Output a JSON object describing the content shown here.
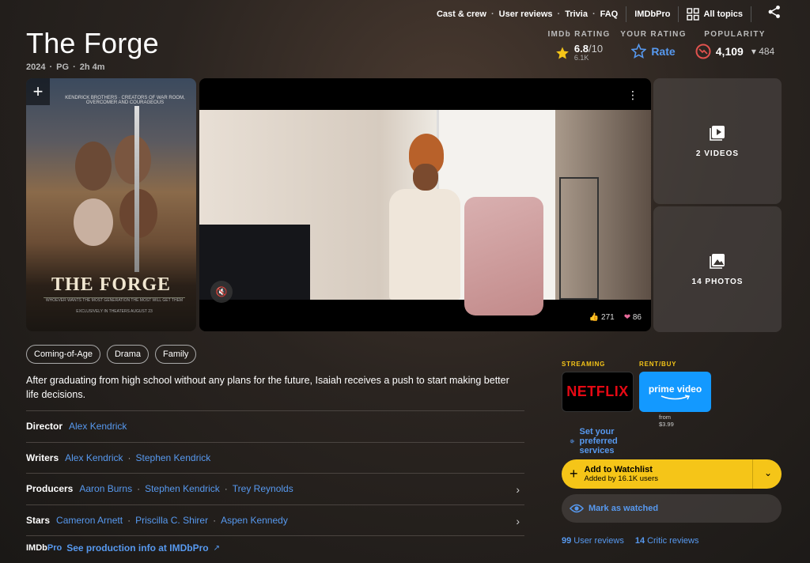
{
  "nav": {
    "links": [
      "Cast & crew",
      "User reviews",
      "Trivia",
      "FAQ"
    ],
    "imdbpro": "IMDbPro",
    "all_topics": "All topics"
  },
  "title": "The Forge",
  "meta": {
    "year": "2024",
    "rating": "PG",
    "runtime": "2h 4m"
  },
  "ratings": {
    "imdb_label": "IMDb RATING",
    "score": "6.8",
    "out_of": "/10",
    "votes": "6.1K",
    "your_label": "YOUR RATING",
    "rate": "Rate",
    "pop_label": "POPULARITY",
    "popularity": "4,109",
    "pop_change": "484"
  },
  "poster": {
    "tagline": "KENDRICK BROTHERS · CREATORS OF WAR ROOM, OVERCOMER AND COURAGEOUS",
    "title": "THE FORGE",
    "subline": "WHOEVER WANTS THE MOST GENERATION THE MOST WILL GET THEM",
    "release": "EXCLUSIVELY IN THEATERS AUGUST 23"
  },
  "video": {
    "likes": "271",
    "reactions": "86"
  },
  "tiles": {
    "videos": "2 VIDEOS",
    "photos": "14 PHOTOS"
  },
  "genres": [
    "Coming-of-Age",
    "Drama",
    "Family"
  ],
  "plot": "After graduating from high school without any plans for the future, Isaiah receives a push to start making better life decisions.",
  "credits": {
    "director_label": "Director",
    "director": [
      "Alex Kendrick"
    ],
    "writers_label": "Writers",
    "writers": [
      "Alex Kendrick",
      "Stephen Kendrick"
    ],
    "producers_label": "Producers",
    "producers": [
      "Aaron Burns",
      "Stephen Kendrick",
      "Trey Reynolds"
    ],
    "stars_label": "Stars",
    "stars": [
      "Cameron Arnett",
      "Priscilla C. Shirer",
      "Aspen Kennedy"
    ]
  },
  "pro": {
    "logo_a": "IMDb",
    "logo_b": "Pro",
    "link": "See production info at IMDbPro"
  },
  "streaming": {
    "streaming_label": "STREAMING",
    "rent_label": "RENT/BUY",
    "netflix": "NETFLIX",
    "prime": "prime video",
    "from": "from $3.99",
    "pref": "Set your preferred services"
  },
  "watchlist": {
    "label": "Add to Watchlist",
    "sub": "Added by 16.1K users"
  },
  "marked": "Mark as watched",
  "reviews": {
    "user_count": "99",
    "user_label": "User reviews",
    "critic_count": "14",
    "critic_label": "Critic reviews"
  },
  "colors": {
    "accent": "#f5c518",
    "link": "#5799ef",
    "netflix": "#e50914",
    "prime": "#1399ff"
  }
}
